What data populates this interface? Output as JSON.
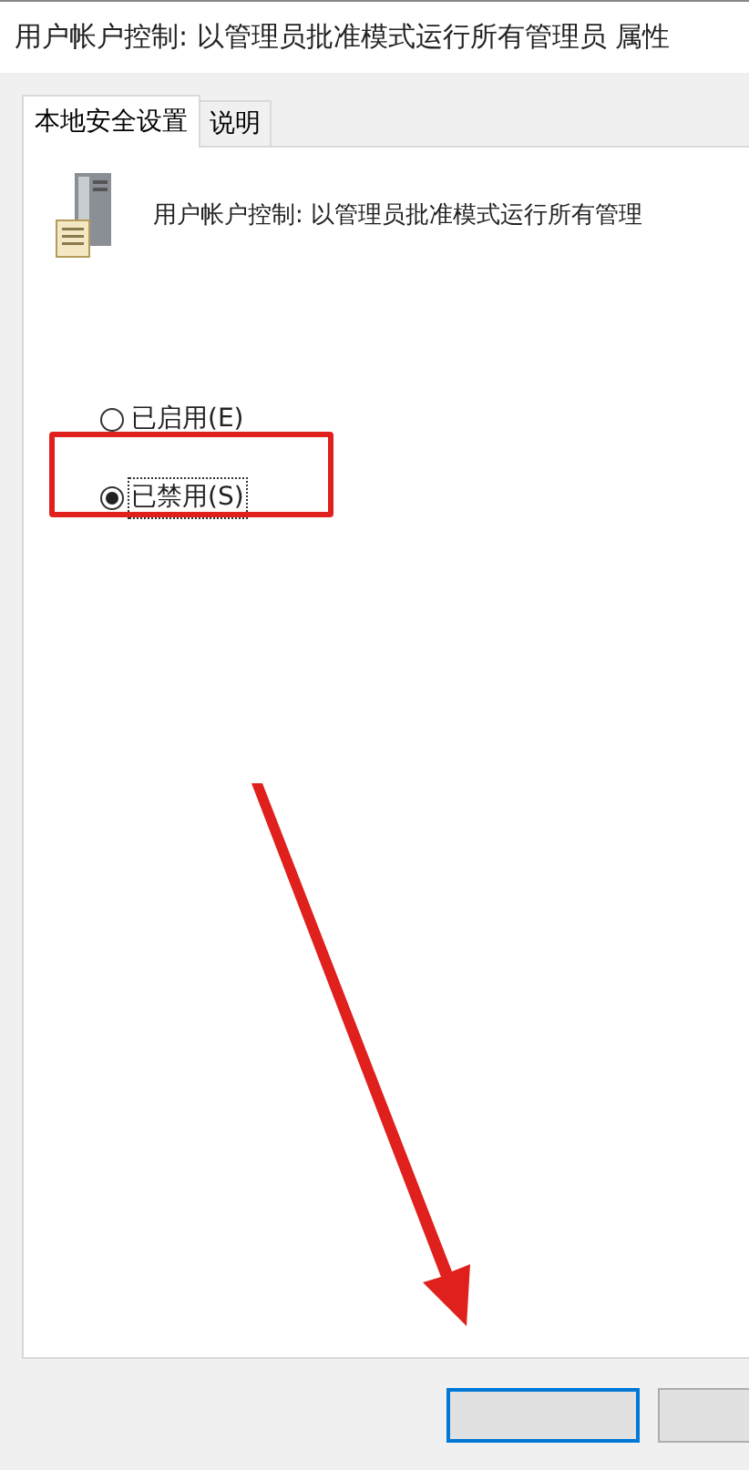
{
  "window": {
    "title": "用户帐户控制: 以管理员批准模式运行所有管理员 属性"
  },
  "tabs": [
    {
      "label": "本地安全设置",
      "selected": true
    },
    {
      "label": "说明",
      "selected": false
    }
  ],
  "policy": {
    "text": "用户帐户控制: 以管理员批准模式运行所有管理"
  },
  "options": [
    {
      "label": "已启用(E)",
      "selected": false
    },
    {
      "label": "已禁用(S)",
      "selected": true
    }
  ],
  "annotations": {
    "highlight_frame": true,
    "arrow": true
  }
}
